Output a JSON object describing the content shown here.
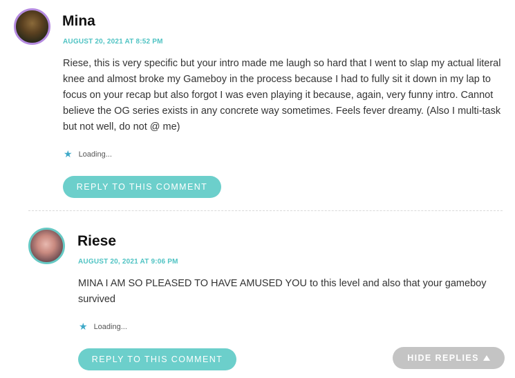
{
  "comments": [
    {
      "author": "Mina",
      "date": "AUGUST 20, 2021 AT 8:52 PM",
      "body": "Riese, this is very specific but your intro made me laugh so hard that I went to slap my actual literal knee and almost broke my Gameboy in the process because I had to fully sit it down in my lap to focus on your recap but also forgot I was even playing it because, again, very funny intro. Cannot believe the OG series exists in any concrete way sometimes. Feels fever dreamy. (Also I multi-task but not well, do not @ me)",
      "like_status": "Loading...",
      "reply_label": "REPLY TO THIS COMMENT"
    },
    {
      "author": "Riese",
      "date": "AUGUST 20, 2021 AT 9:06 PM",
      "body": "MINA I AM SO PLEASED TO HAVE AMUSED YOU to this level and also that your gameboy survived",
      "like_status": "Loading...",
      "reply_label": "REPLY TO THIS COMMENT"
    }
  ],
  "hide_replies_label": "HIDE REPLIES",
  "colors": {
    "accent": "#6ccfcb",
    "date": "#4fc3c3",
    "star": "#3ea9c8",
    "hide_button": "#c4c4c4"
  },
  "icons": {
    "like": "star-icon",
    "toggle": "triangle-up-icon"
  }
}
